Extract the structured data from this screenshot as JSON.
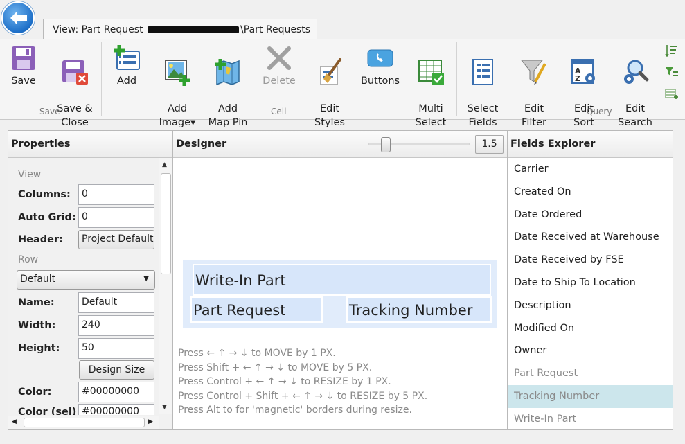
{
  "window": {
    "tab_title_prefix": "View: Part Request",
    "tab_title_suffix": "\\Part Requests"
  },
  "ribbon": {
    "buttons": [
      {
        "id": "save",
        "label": "Save",
        "icon": "save-icon"
      },
      {
        "id": "save-close",
        "label": "Save &\nClose",
        "icon": "save-close-icon"
      },
      {
        "id": "add",
        "label": "Add",
        "icon": "add-icon"
      },
      {
        "id": "add-image",
        "label": "Add\nImage▾",
        "icon": "add-image-icon"
      },
      {
        "id": "add-map-pin",
        "label": "Add\nMap Pin",
        "icon": "map-pin-icon"
      },
      {
        "id": "delete",
        "label": "Delete",
        "icon": "delete-icon",
        "disabled": true
      },
      {
        "id": "edit-styles",
        "label": "Edit\nStyles",
        "icon": "brush-icon"
      },
      {
        "id": "buttons",
        "label": "Buttons",
        "icon": "phone-button-icon"
      },
      {
        "id": "multi-select",
        "label": "Multi\nSelect",
        "icon": "multi-select-icon"
      },
      {
        "id": "select-fields",
        "label": "Select\nFields",
        "icon": "document-icon"
      },
      {
        "id": "edit-filter",
        "label": "Edit\nFilter",
        "icon": "filter-icon"
      },
      {
        "id": "edit-sort",
        "label": "Edit\nSort",
        "icon": "sort-icon"
      },
      {
        "id": "edit-search",
        "label": "Edit\nSearch",
        "icon": "search-icon"
      }
    ],
    "groups": {
      "save": "Save",
      "cell": "Cell",
      "query": "Query"
    }
  },
  "properties": {
    "title": "Properties",
    "view_section": "View",
    "columns_label": "Columns:",
    "columns_value": "0",
    "autogrid_label": "Auto Grid:",
    "autogrid_value": "0",
    "header_label": "Header:",
    "header_value": "Project Default",
    "row_section": "Row",
    "row_select": "Default",
    "name_label": "Name:",
    "name_value": "Default",
    "width_label": "Width:",
    "width_value": "240",
    "height_label": "Height:",
    "height_value": "50",
    "design_size": "Design Size",
    "color_label": "Color:",
    "color_value": "#00000000",
    "color_sel_label": "Color (sel):",
    "color_sel_value": "#00000000"
  },
  "designer": {
    "title": "Designer",
    "zoom": "1.5",
    "zoom_level": 0.14,
    "cells": {
      "write_in": "Write-In Part",
      "part_request": "Part Request",
      "tracking_number": "Tracking Number"
    },
    "hints": [
      "Press ← ↑ → ↓ to MOVE by 1 PX.",
      "Press Shift + ← ↑ → ↓ to MOVE by 5 PX.",
      "Press Control + ← ↑ → ↓ to RESIZE by 1 PX.",
      "Press Control + Shift + ← ↑ → ↓ to RESIZE by 5 PX.",
      "Press Alt to for 'magnetic' borders during resize."
    ]
  },
  "fields_explorer": {
    "title": "Fields Explorer",
    "items": [
      {
        "label": "Carrier",
        "used": false
      },
      {
        "label": "Created On",
        "used": false
      },
      {
        "label": "Date Ordered",
        "used": false
      },
      {
        "label": "Date Received at Warehouse",
        "used": false
      },
      {
        "label": "Date Received by FSE",
        "used": false
      },
      {
        "label": "Date to Ship To Location",
        "used": false
      },
      {
        "label": "Description",
        "used": false
      },
      {
        "label": "Modified On",
        "used": false
      },
      {
        "label": "Owner",
        "used": false
      },
      {
        "label": "Part Request",
        "used": true
      },
      {
        "label": "Tracking Number",
        "used": true,
        "selected": true
      },
      {
        "label": "Write-In Part",
        "used": true
      }
    ]
  },
  "colors": {
    "accent": "#1d6fc8",
    "selected_row": "#cce6ec",
    "designer_cell": "#d7e6fa"
  }
}
